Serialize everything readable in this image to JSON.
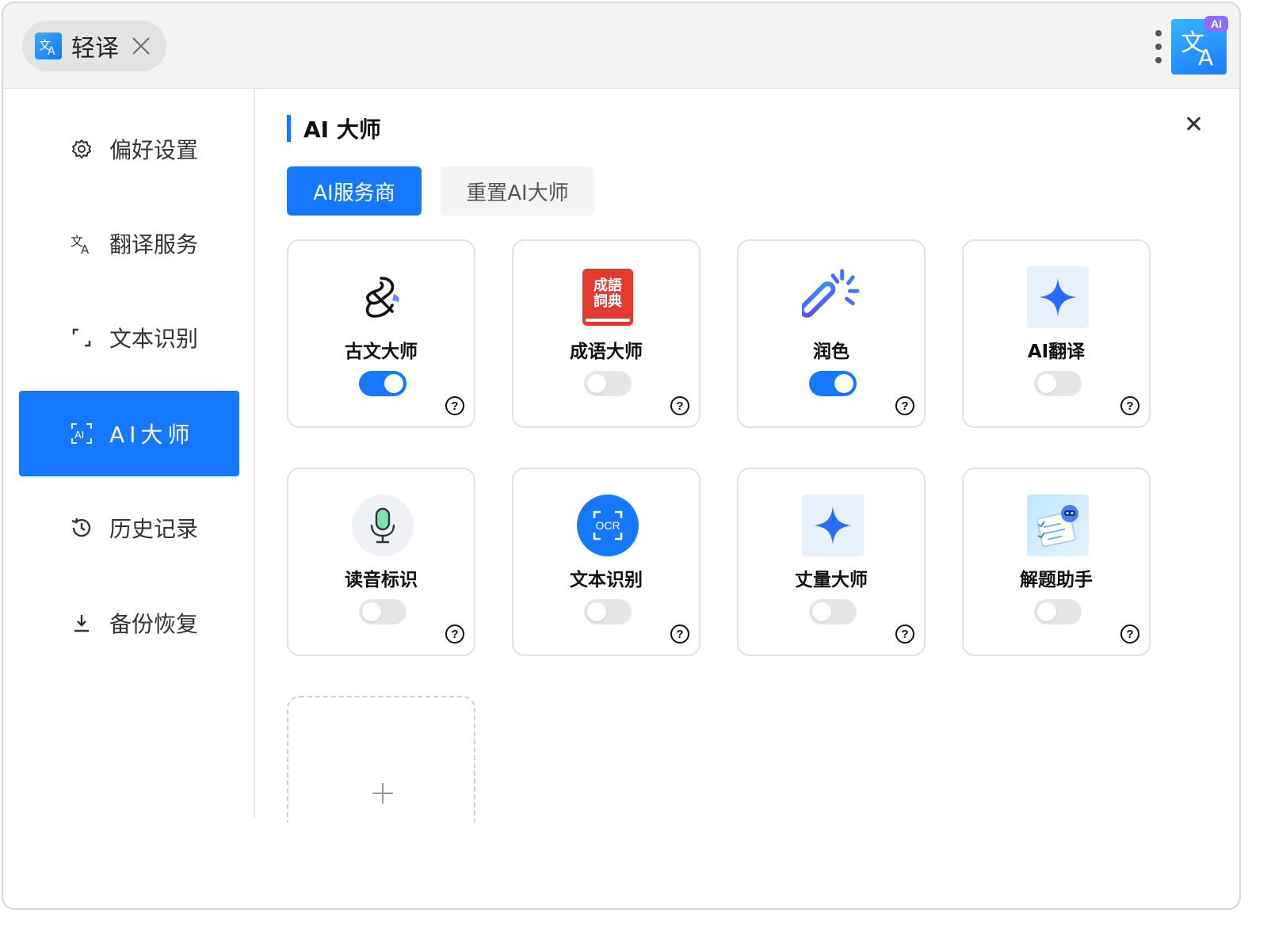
{
  "titlebar": {
    "app_tab_label": "轻译",
    "ai_badge": "Ai"
  },
  "sidebar": {
    "items": [
      {
        "label": "偏好设置",
        "icon": "gear-icon"
      },
      {
        "label": "翻译服务",
        "icon": "translate-icon"
      },
      {
        "label": "文本识别",
        "icon": "scan-icon"
      },
      {
        "label": "AI大师",
        "icon": "ai-icon",
        "active": true
      },
      {
        "label": "历史记录",
        "icon": "history-icon"
      },
      {
        "label": "备份恢复",
        "icon": "download-icon"
      }
    ]
  },
  "main": {
    "title": "AI 大师",
    "buttons": {
      "providers": "AI服务商",
      "reset": "重置AI大师"
    },
    "cards": [
      {
        "title": "古文大师",
        "enabled": true,
        "icon": "brush-icon"
      },
      {
        "title": "成语大师",
        "enabled": false,
        "icon": "idiom-dictionary-icon",
        "icon_text": "成語詞典"
      },
      {
        "title": "润色",
        "enabled": true,
        "icon": "magic-wand-icon"
      },
      {
        "title": "AI翻译",
        "enabled": false,
        "icon": "sparkle-icon"
      },
      {
        "title": "读音标识",
        "enabled": false,
        "icon": "microphone-icon"
      },
      {
        "title": "文本识别",
        "enabled": false,
        "icon": "ocr-icon",
        "icon_text": "OCR"
      },
      {
        "title": "丈量大师",
        "enabled": false,
        "icon": "sparkle-icon"
      },
      {
        "title": "解题助手",
        "enabled": false,
        "icon": "robot-worksheet-icon"
      }
    ],
    "help_glyph": "?"
  },
  "colors": {
    "accent": "#1677ff",
    "toggle_off": "#e6e6e6",
    "badge": "#8b6cff"
  }
}
